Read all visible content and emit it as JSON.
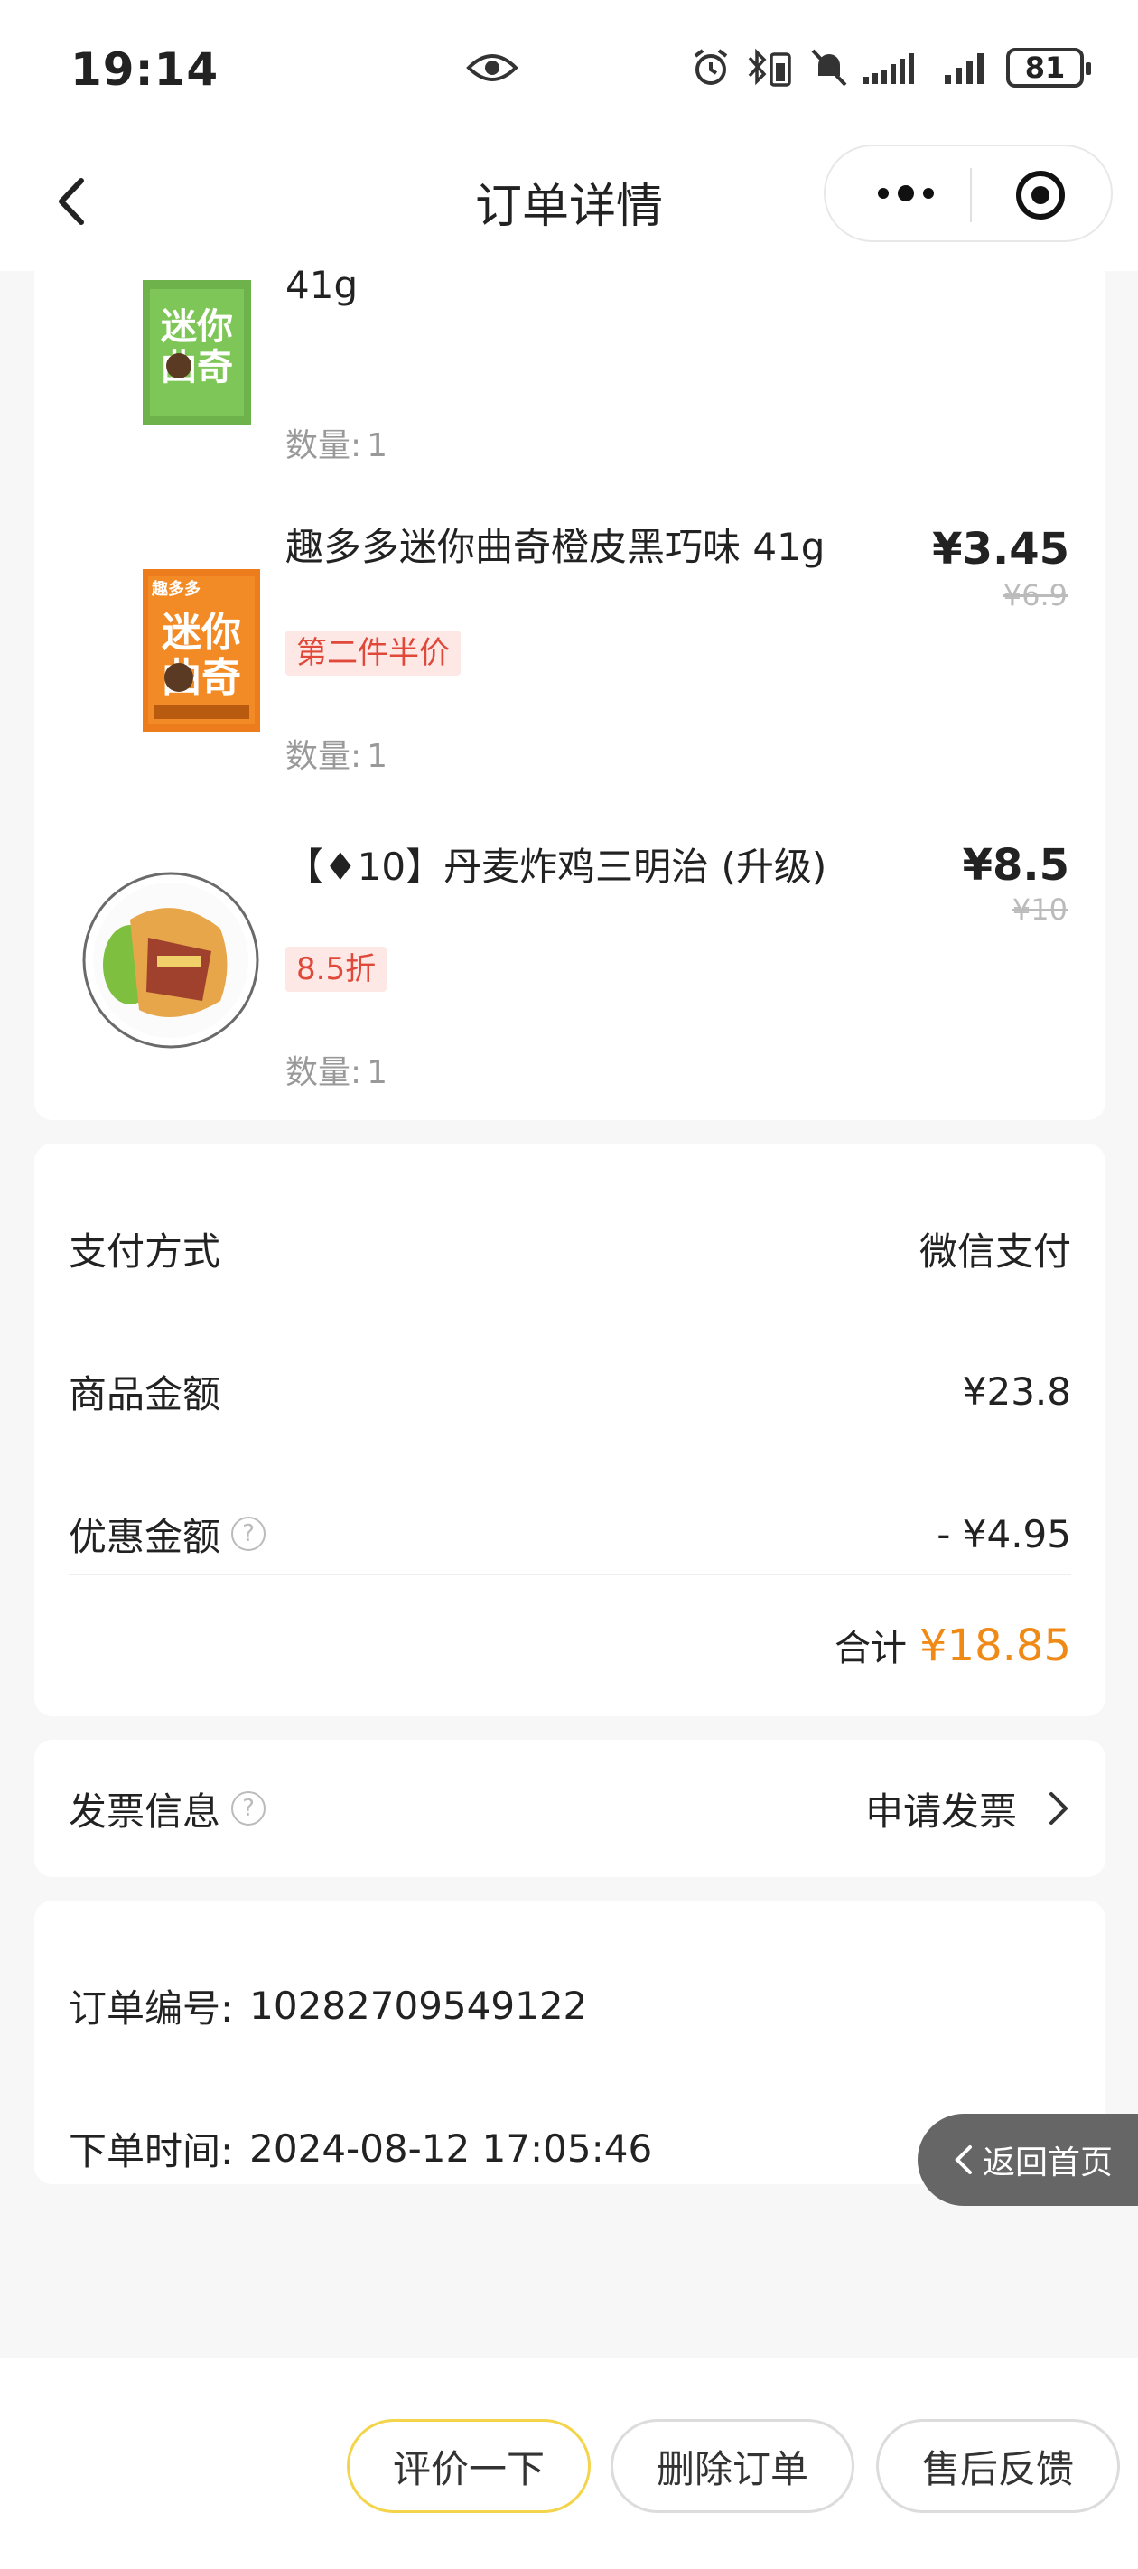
{
  "status_bar": {
    "time": "19:14",
    "battery": "81"
  },
  "nav": {
    "title": "订单详情"
  },
  "products": [
    {
      "name": "41g",
      "tag": "",
      "price": "",
      "original_price": "",
      "qty_label": "数量:",
      "qty": "1"
    },
    {
      "name": "趣多多迷你曲奇橙皮黑巧味 41g",
      "tag": "第二件半价",
      "price": "¥3.45",
      "original_price": "¥6.9",
      "qty_label": "数量:",
      "qty": "1"
    },
    {
      "name": "【♦10】丹麦炸鸡三明治 (升级)",
      "tag": "8.5折",
      "price": "¥8.5",
      "original_price": "¥10",
      "qty_label": "数量:",
      "qty": "1"
    }
  ],
  "payment": {
    "method_label": "支付方式",
    "method_value": "微信支付",
    "goods_label": "商品金额",
    "goods_value": "¥23.8",
    "discount_label": "优惠金额",
    "discount_value": "- ¥4.95",
    "total_label": "合计",
    "total_value": "¥18.85"
  },
  "invoice": {
    "label": "发票信息",
    "action": "申请发票"
  },
  "order": {
    "number_label": "订单编号:",
    "number": "10282709549122",
    "time_label": "下单时间:",
    "time": "2024-08-12 17:05:46"
  },
  "float_home": {
    "label": "返回首页"
  },
  "buttons": {
    "review": "评价一下",
    "delete": "删除订单",
    "after_sale": "售后反馈"
  },
  "colors": {
    "accent_price": "#f08a17",
    "tag_red": "#e0483a",
    "primary_border": "#f3d44a"
  }
}
